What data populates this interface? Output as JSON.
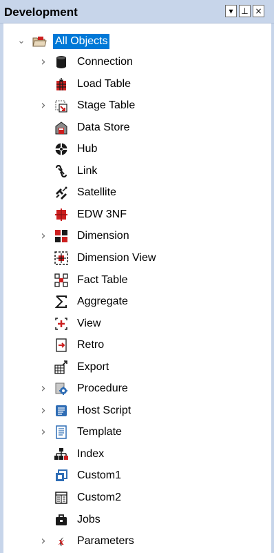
{
  "panel": {
    "title": "Development",
    "buttons": {
      "dropdown": "▾",
      "pin": "⊥",
      "close": "×"
    }
  },
  "tree": {
    "root": {
      "label": "All Objects",
      "expanded": true,
      "selected": true,
      "icon": "folder-open-icon"
    },
    "items": [
      {
        "label": "Connection",
        "expandable": true,
        "icon": "connection-icon"
      },
      {
        "label": "Load Table",
        "expandable": false,
        "icon": "load-table-icon"
      },
      {
        "label": "Stage Table",
        "expandable": true,
        "icon": "stage-table-icon"
      },
      {
        "label": "Data Store",
        "expandable": false,
        "icon": "data-store-icon"
      },
      {
        "label": "Hub",
        "expandable": false,
        "icon": "hub-icon"
      },
      {
        "label": "Link",
        "expandable": false,
        "icon": "link-icon"
      },
      {
        "label": "Satellite",
        "expandable": false,
        "icon": "satellite-icon"
      },
      {
        "label": "EDW 3NF",
        "expandable": false,
        "icon": "edw-3nf-icon"
      },
      {
        "label": "Dimension",
        "expandable": true,
        "icon": "dimension-icon"
      },
      {
        "label": "Dimension View",
        "expandable": false,
        "icon": "dimension-view-icon"
      },
      {
        "label": "Fact Table",
        "expandable": false,
        "icon": "fact-table-icon"
      },
      {
        "label": "Aggregate",
        "expandable": false,
        "icon": "aggregate-icon"
      },
      {
        "label": "View",
        "expandable": false,
        "icon": "view-icon"
      },
      {
        "label": "Retro",
        "expandable": false,
        "icon": "retro-icon"
      },
      {
        "label": "Export",
        "expandable": false,
        "icon": "export-icon"
      },
      {
        "label": "Procedure",
        "expandable": true,
        "icon": "procedure-icon"
      },
      {
        "label": "Host Script",
        "expandable": true,
        "icon": "host-script-icon"
      },
      {
        "label": "Template",
        "expandable": true,
        "icon": "template-icon"
      },
      {
        "label": "Index",
        "expandable": false,
        "icon": "index-icon"
      },
      {
        "label": "Custom1",
        "expandable": false,
        "icon": "custom1-icon"
      },
      {
        "label": "Custom2",
        "expandable": false,
        "icon": "custom2-icon"
      },
      {
        "label": "Jobs",
        "expandable": false,
        "icon": "jobs-icon"
      },
      {
        "label": "Parameters",
        "expandable": true,
        "icon": "parameters-icon"
      }
    ]
  },
  "colors": {
    "selection": "#0078d7",
    "titlebar": "#c7d5ea",
    "red": "#cc1f1f",
    "blue": "#2f6db5"
  }
}
